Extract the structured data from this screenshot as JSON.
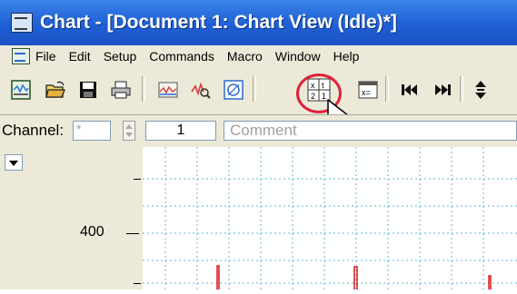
{
  "window": {
    "title": "Chart - [Document 1: Chart View (Idle)*]"
  },
  "menu": {
    "items": [
      "File",
      "Edit",
      "Setup",
      "Commands",
      "Macro",
      "Window",
      "Help"
    ]
  },
  "toolbar": {
    "buttons": [
      "chart-view-icon",
      "open-folder-icon",
      "save-disk-icon",
      "print-icon",
      "scope-view-icon",
      "zoom-view-icon",
      "xy-view-icon",
      "data-pad-icon",
      "calculator-icon",
      "go-first-icon",
      "go-last-icon",
      "channel-scroll-icon"
    ],
    "highlighted_button": "data-pad-icon"
  },
  "channel_bar": {
    "label": "Channel:",
    "selector_value": "*",
    "channel_number": "1",
    "comment_placeholder": "Comment"
  },
  "axis": {
    "label_400": "400"
  },
  "colors": {
    "title_bar": "#2565d8",
    "highlight_ring": "#e0223b",
    "grid": "#5fb7d6",
    "trace": "#d8242a"
  }
}
